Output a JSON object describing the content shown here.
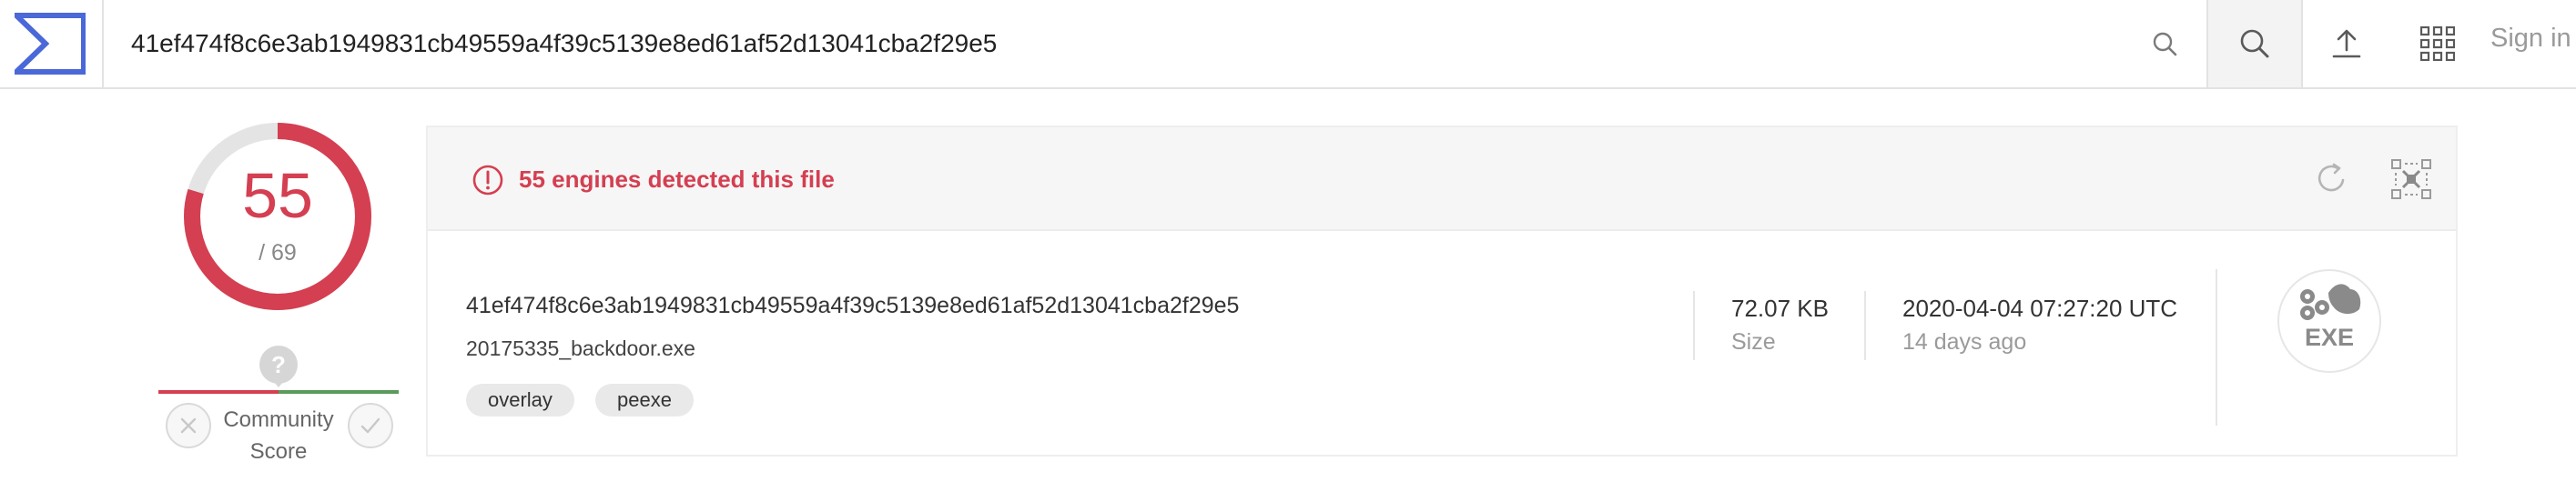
{
  "search": {
    "value": "41ef474f8c6e3ab1949831cb49559a4f39c5139e8ed61af52d13041cba2f29e5"
  },
  "header": {
    "sign_in": "Sign in"
  },
  "score": {
    "detections": "55",
    "total": "/ 69",
    "ratio": 0.797
  },
  "community": {
    "label_line1": "Community",
    "label_line2": "Score",
    "marker": "?"
  },
  "alert": {
    "text": "55 engines detected this file"
  },
  "file": {
    "hash": "41ef474f8c6e3ab1949831cb49559a4f39c5139e8ed61af52d13041cba2f29e5",
    "name": "20175335_backdoor.exe",
    "tags": [
      "overlay",
      "peexe"
    ],
    "size_value": "72.07 KB",
    "size_label": "Size",
    "date": "2020-04-04 07:27:20 UTC",
    "date_ago": "14 days ago",
    "type_label": "EXE"
  },
  "colors": {
    "danger": "#d43f51",
    "accent": "#4a68d8",
    "clean": "#5a9a5a"
  },
  "icons": [
    "sigma-logo-icon",
    "search-icon",
    "upload-icon",
    "apps-grid-icon",
    "alert-icon",
    "reanalyze-icon",
    "similar-icon",
    "thumbs-down-icon",
    "thumbs-up-icon",
    "exe-file-icon"
  ]
}
